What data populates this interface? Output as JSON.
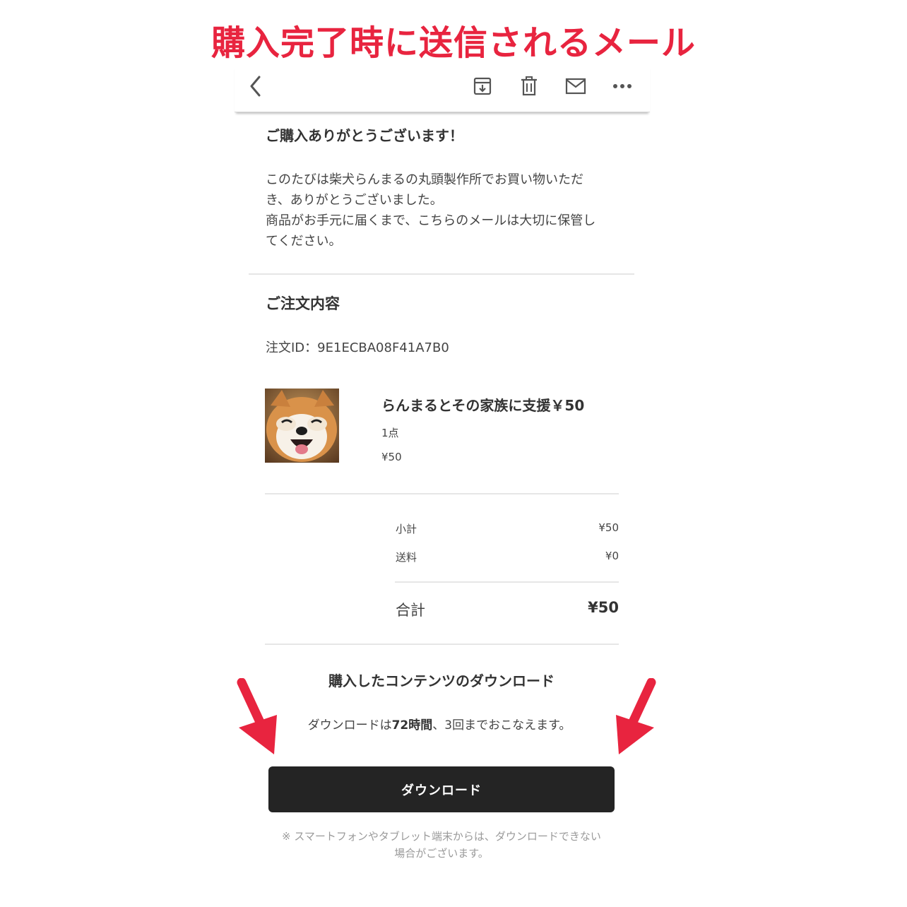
{
  "headline": {
    "text": "購入完了時に送信されるメール",
    "color": "#e8243f"
  },
  "toolbar": {
    "back_icon": "chevron-left-icon",
    "actions": [
      "archive-icon",
      "trash-icon",
      "mail-icon",
      "more-icon"
    ]
  },
  "email": {
    "greeting": "ご購入ありがとうございます！",
    "message_lines": [
      "このたびは柴犬らんまるの丸頭製作所でお買い物いただ",
      "き、ありがとうございました。",
      "商品がお手元に届くまで、こちらのメールは大切に保管し",
      "てください。"
    ],
    "order_section_title": "ご注文内容",
    "order_id": "注文ID：9E1ECBA08F41A7B0",
    "product": {
      "name": "らんまるとその家族に支援￥50",
      "quantity": "1点",
      "price": "¥50"
    },
    "summary": {
      "subtotal_label": "小計",
      "subtotal_value": "¥50",
      "shipping_label": "送料",
      "shipping_value": "¥0",
      "total_label": "合計",
      "total_value": "¥50"
    },
    "download": {
      "title": "購入したコンテンツのダウンロード",
      "desc_prefix": "ダウンロードは",
      "desc_bold": "72時間",
      "desc_suffix": "、3回までおこなえます。",
      "button_label": "ダウンロード",
      "note_lines": [
        "※ スマートフォンやタブレット端末からは、ダウンロードできない",
        "場合がございます。"
      ]
    }
  },
  "annotations": {
    "arrow_color": "#e8243f"
  }
}
